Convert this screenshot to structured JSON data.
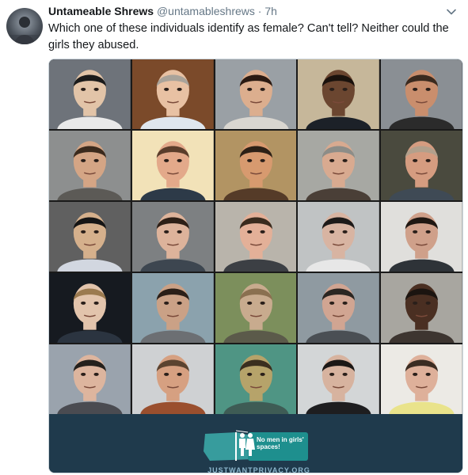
{
  "tweet": {
    "display_name": "Untameable Shrews",
    "handle": "@untamableshrews",
    "separator": "·",
    "time": "7h",
    "text": "Which one of these individuals identify as female? Can't tell? Neither could the girls they abused.",
    "menu_icon": "chevron-down-icon",
    "avatar_icon": "avatar"
  },
  "media": {
    "grid_columns": 5,
    "grid_rows": 5,
    "photos": [
      {
        "bg": "#6e737a",
        "skin": "#e2c4a8",
        "hair": "#1b1b1b",
        "shirt": "#e9e9e9"
      },
      {
        "bg": "#7b4a2a",
        "skin": "#e8c1a3",
        "hair": "#a9a39a",
        "shirt": "#dfe6ee"
      },
      {
        "bg": "#9aa0a5",
        "skin": "#dcae8e",
        "hair": "#2a1a12",
        "shirt": "#d9d6d0"
      },
      {
        "bg": "#c6b79a",
        "skin": "#6b4630",
        "hair": "#1a120d",
        "shirt": "#1c2128"
      },
      {
        "bg": "#8a8f94",
        "skin": "#c98e6d",
        "hair": "#3a2a1f",
        "shirt": "#2b2b2b"
      },
      {
        "bg": "#8d8f8f",
        "skin": "#d4a585",
        "hair": "#3b2a1d",
        "shirt": "#5c5a56"
      },
      {
        "bg": "#f2e2b8",
        "skin": "#e3a98a",
        "hair": "#5a3d2b",
        "shirt": "#2d3a48"
      },
      {
        "bg": "#b29463",
        "skin": "#d79a6f",
        "hair": "#2c2016",
        "shirt": "#553b28"
      },
      {
        "bg": "#a7a8a3",
        "skin": "#d8aa90",
        "hair": "#8d8d88",
        "shirt": "#4a3f37"
      },
      {
        "bg": "#4a4a3e",
        "skin": "#d59c80",
        "hair": "#b2a08c",
        "shirt": "#3f4a55"
      },
      {
        "bg": "#606060",
        "skin": "#d5b08c",
        "hair": "#151515",
        "shirt": "#d2d7e0"
      },
      {
        "bg": "#7d8082",
        "skin": "#ddb39b",
        "hair": "#2d1f16",
        "shirt": "#3d4650"
      },
      {
        "bg": "#b9b4ab",
        "skin": "#e3b098",
        "hair": "#3a2b1e",
        "shirt": "#3c3f44"
      },
      {
        "bg": "#c0c3c4",
        "skin": "#d8b4a2",
        "hair": "#1d1a19",
        "shirt": "#e7e7e7"
      },
      {
        "bg": "#e0dfdc",
        "skin": "#cfa08a",
        "hair": "#1f1712",
        "shirt": "#2e3338"
      },
      {
        "bg": "#161a20",
        "skin": "#e2c4ac",
        "hair": "#9b7a4f",
        "shirt": "#2b3440"
      },
      {
        "bg": "#8ba2ad",
        "skin": "#caa186",
        "hair": "#2a1f18",
        "shirt": "#6c6f73"
      },
      {
        "bg": "#7c8f5c",
        "skin": "#c8ab8e",
        "hair": "#8a7050",
        "shirt": "#5b5a4a"
      },
      {
        "bg": "#8f9aa1",
        "skin": "#d1a592",
        "hair": "#2b2622",
        "shirt": "#4a4f54"
      },
      {
        "bg": "#a8a6a0",
        "skin": "#4a2f22",
        "hair": "#1b1410",
        "shirt": "#3d3530"
      },
      {
        "bg": "#9aa3ad",
        "skin": "#ddb59e",
        "hair": "#25211d",
        "shirt": "#4a4b51"
      },
      {
        "bg": "#cfd1d3",
        "skin": "#d6a081",
        "hair": "#5b4330",
        "shirt": "#9a4f2e"
      },
      {
        "bg": "#4f9584",
        "skin": "#b6a36a",
        "hair": "#3a2e1f",
        "shirt": "#3e5c55"
      },
      {
        "bg": "#d3d6d7",
        "skin": "#d7b39f",
        "hair": "#1b1816",
        "shirt": "#1e1e20"
      },
      {
        "bg": "#eceae5",
        "skin": "#deb09a",
        "hair": "#3b2c22",
        "shirt": "#e9e38b"
      }
    ],
    "banner": {
      "badge_text": "No men in girls' spaces!",
      "url_text": "JUSTWANTPRIVACY.ORG",
      "map_color": "#3aa7a6",
      "badge_color": "#1e8f8e"
    }
  }
}
